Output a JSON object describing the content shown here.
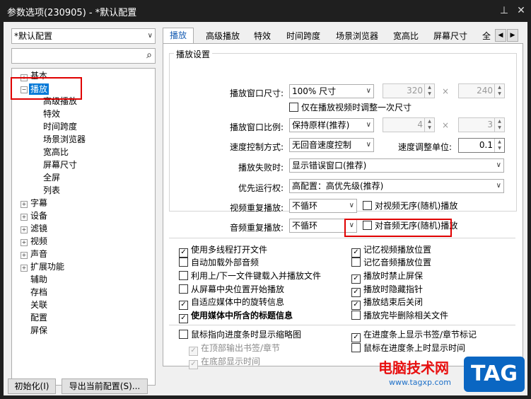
{
  "window": {
    "title": "参数选项(230905) - *默认配置",
    "pin_icon": "pin-icon",
    "close_icon": "close-icon"
  },
  "sidebar": {
    "profile_combo": "*默认配置",
    "search_placeholder": "",
    "tree": {
      "basic": "基本",
      "play": "播放",
      "play_children": [
        "高级播放",
        "特效",
        "时间跨度",
        "场景浏览器",
        "宽高比",
        "屏幕尺寸",
        "全屏",
        "列表"
      ],
      "subtitle": "字幕",
      "device": "设备",
      "filter": "滤镜",
      "video": "视频",
      "audio": "声音",
      "extend": "扩展功能",
      "assist": "辅助",
      "storage": "存档",
      "assoc": "关联",
      "config": "配置",
      "screensaver": "屏保"
    }
  },
  "tabs": [
    "播放",
    "高级播放",
    "特效",
    "时间跨度",
    "场景浏览器",
    "宽高比",
    "屏幕尺寸",
    "全"
  ],
  "playback": {
    "group_title": "播放设置",
    "window_size_label": "播放窗口尺寸:",
    "window_size_value": "100% 尺寸",
    "width_value": "320",
    "height_value": "240",
    "times": "×",
    "only_adjust_once": "仅在播放视频时调整一次尺寸",
    "ratio_label": "播放窗口比例:",
    "ratio_value": "保持原样(推荐)",
    "ratio_w": "4",
    "ratio_h": "3",
    "speed_label": "速度控制方式:",
    "speed_value": "无回音速度控制",
    "speed_unit_label": "速度调整单位:",
    "speed_unit_value": "0.1",
    "fail_label": "播放失败时:",
    "fail_value": "显示错误窗口(推荐)",
    "priority_label": "优先运行权:",
    "priority_value": "高配置：高优先级(推荐)",
    "video_repeat_label": "视频重复播放:",
    "video_repeat_value": "不循环",
    "video_random": "对视频无序(随机)播放",
    "audio_repeat_label": "音频重复播放:",
    "audio_repeat_value": "不循环",
    "audio_random": "对音频无序(随机)播放"
  },
  "options_left": [
    {
      "label": "使用多线程打开文件",
      "checked": true
    },
    {
      "label": "自动加载外部音频",
      "checked": false
    },
    {
      "label": "利用上/下一文件键载入并播放文件",
      "checked": false
    },
    {
      "label": "从屏幕中央位置开始播放",
      "checked": false
    },
    {
      "label": "自适应媒体中的旋转信息",
      "checked": true
    },
    {
      "label": "使用媒体中所含的标题信息",
      "checked": true
    }
  ],
  "options_right": [
    {
      "label": "记忆视频播放位置",
      "checked": true
    },
    {
      "label": "记忆音频播放位置",
      "checked": false
    },
    {
      "label": "播放时禁止屏保",
      "checked": true
    },
    {
      "label": "播放时隐藏指针",
      "checked": true
    },
    {
      "label": "播放结束后关闭",
      "checked": true
    },
    {
      "label": "播放完毕删除相关文件",
      "checked": false
    }
  ],
  "thumbnail": {
    "show_thumb": "鼠标指向进度条时显示缩略图",
    "top_bookmark": "在顶部输出书签/章节",
    "bottom_time": "在底部显示时间",
    "seek_bookmark": "在进度条上显示书签/章节标记",
    "seek_time": "鼠标在进度条上时显示时间"
  },
  "buttons": {
    "init": "初始化(I)",
    "export": "导出当前配置(S)..."
  },
  "watermark": {
    "site_name": "电脑技术网",
    "url": "www.tagxp.com",
    "tag": "TAG"
  },
  "colors": {
    "highlight": "#0078d7",
    "annotation": "#e00000"
  }
}
